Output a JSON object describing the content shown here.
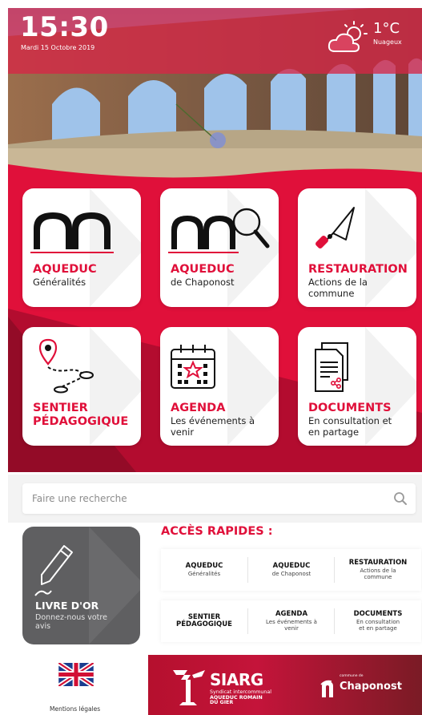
{
  "header": {
    "time": "15:30",
    "date": "Mardi 15 Octobre 2019",
    "weather": {
      "icon": "partly-cloudy-icon",
      "temperature": "1°C",
      "condition": "Nuageux"
    }
  },
  "tiles": [
    {
      "title": "AQUEDUC",
      "subtitle": "Généralités",
      "icon": "aqueduct-arches-icon"
    },
    {
      "title": "AQUEDUC",
      "subtitle": "de Chaponost",
      "icon": "aqueduct-magnifier-icon"
    },
    {
      "title": "RESTAURATION",
      "subtitle": "Actions de la commune",
      "icon": "trowel-icon"
    },
    {
      "title": "SENTIER PÉDAGOGIQUE",
      "subtitle": "",
      "icon": "trail-map-pin-icon"
    },
    {
      "title": "AGENDA",
      "subtitle": "Les événements à venir",
      "icon": "calendar-star-icon"
    },
    {
      "title": "DOCUMENTS",
      "subtitle": "En consultation et en partage",
      "icon": "documents-share-icon"
    }
  ],
  "search": {
    "placeholder": "Faire une recherche",
    "icon": "search-icon"
  },
  "guestbook": {
    "title": "LIVRE D'OR",
    "subtitle": "Donnez-nous votre avis",
    "icon": "pen-icon"
  },
  "quick_access": {
    "title": "ACCÈS RAPIDES :",
    "rows": [
      [
        {
          "title": "AQUEDUC",
          "subtitle": "Généralités"
        },
        {
          "title": "AQUEDUC",
          "subtitle": "de Chaponost"
        },
        {
          "title": "RESTAURATION",
          "subtitle": "Actions de la commune"
        }
      ],
      [
        {
          "title": "SENTIER PÉDAGOGIQUE",
          "subtitle": ""
        },
        {
          "title": "AGENDA",
          "subtitle": "Les événements à venir"
        },
        {
          "title": "DOCUMENTS",
          "subtitle": "En consultation et en partage"
        }
      ]
    ]
  },
  "footer": {
    "language_flag": "uk-flag-icon",
    "legal_link": "Mentions légales",
    "siarg": {
      "name": "SIARG",
      "tagline_1": "Syndicat intercommunal",
      "tagline_2": "AQUEDUC ROMAIN",
      "tagline_3": "DU GIER"
    },
    "chaponost": {
      "prefix": "commune de",
      "name": "Chaponost"
    }
  },
  "colors": {
    "accent": "#e0103a",
    "guestbook_bg": "#5f5f61",
    "footer_dark": "#7a1b25"
  }
}
